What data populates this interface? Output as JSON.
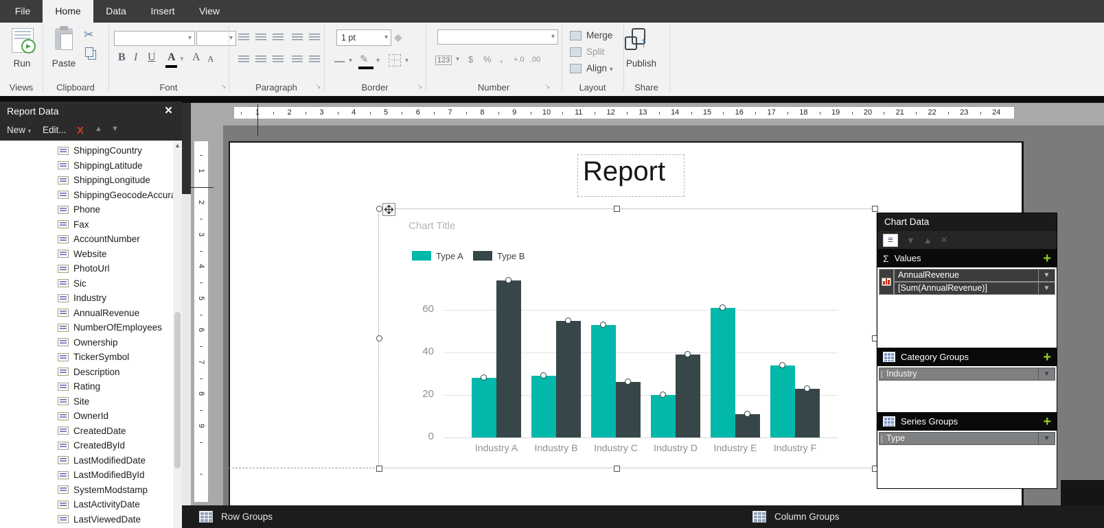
{
  "menu": {
    "tabs": [
      {
        "label": "File",
        "active": false
      },
      {
        "label": "Home",
        "active": true
      },
      {
        "label": "Data",
        "active": false
      },
      {
        "label": "Insert",
        "active": false
      },
      {
        "label": "View",
        "active": false
      }
    ]
  },
  "ribbon": {
    "group_labels": [
      "Views",
      "Clipboard",
      "Font",
      "Paragraph",
      "Border",
      "Number",
      "Layout",
      "Share"
    ],
    "run_label": "Run",
    "paste_label": "Paste",
    "bold_label": "B",
    "italic_label": "I",
    "underline_label": "U",
    "font_color_label": "A",
    "grow_font_label": "A",
    "shrink_font_label": "A",
    "border_width_value": "1 pt",
    "number_format_label": "123",
    "currency_label": "$",
    "percent_label": "%",
    "comma_label": ",",
    "inc_decimal_label": "+.0",
    "dec_decimal_label": ".00",
    "merge_label": "Merge",
    "split_label": "Split",
    "align_label": "Align",
    "publish_label": "Publish"
  },
  "report_data_panel": {
    "title": "Report Data",
    "toolbar": {
      "new_label": "New",
      "edit_label": "Edit..."
    },
    "fields": [
      "ShippingCountry",
      "ShippingLatitude",
      "ShippingLongitude",
      "ShippingGeocodeAccura",
      "Phone",
      "Fax",
      "AccountNumber",
      "Website",
      "PhotoUrl",
      "Sic",
      "Industry",
      "AnnualRevenue",
      "NumberOfEmployees",
      "Ownership",
      "TickerSymbol",
      "Description",
      "Rating",
      "Site",
      "OwnerId",
      "CreatedDate",
      "CreatedById",
      "LastModifiedDate",
      "LastModifiedById",
      "SystemModstamp",
      "LastActivityDate",
      "LastViewedDate"
    ]
  },
  "page": {
    "h_ruler_numbers": [
      1,
      2,
      3,
      4,
      5,
      6,
      7,
      8,
      9,
      10,
      11,
      12,
      13,
      14,
      15,
      16,
      17,
      18,
      19,
      20,
      21,
      22,
      23,
      24
    ],
    "v_ruler_numbers": [
      1,
      2,
      3,
      4,
      5,
      6,
      7,
      8,
      9
    ]
  },
  "report": {
    "title": "Report"
  },
  "chart_data": {
    "type": "bar",
    "title": "Chart Title",
    "categories": [
      "Industry A",
      "Industry B",
      "Industry C",
      "Industry D",
      "Industry E",
      "Industry F"
    ],
    "series": [
      {
        "name": "Type A",
        "color": "#01B8AA",
        "values": [
          28,
          29,
          53,
          20,
          61,
          34
        ]
      },
      {
        "name": "Type B",
        "color": "#374649",
        "values": [
          74,
          55,
          26,
          39,
          11,
          23
        ]
      }
    ],
    "xlabel": "",
    "ylabel": "",
    "ylim": [
      0,
      80
    ],
    "yticks": [
      0,
      20,
      40,
      60
    ],
    "grid": true,
    "legend_position": "top-left"
  },
  "chart_data_panel": {
    "title": "Chart Data",
    "values_section": {
      "label": "Values",
      "field": "AnnualRevenue",
      "expression": "[Sum(AnnualRevenue)]"
    },
    "category_section": {
      "label": "Category Groups",
      "row": "Industry"
    },
    "series_section": {
      "label": "Series Groups",
      "row": "Type"
    }
  },
  "bottom_bar": {
    "row_groups_label": "Row Groups",
    "column_groups_label": "Column Groups"
  },
  "colors": {
    "accent_teal": "#01B8AA",
    "accent_dark": "#374649",
    "add_button_green": "#97ca28",
    "delete_red": "#d2401e"
  }
}
